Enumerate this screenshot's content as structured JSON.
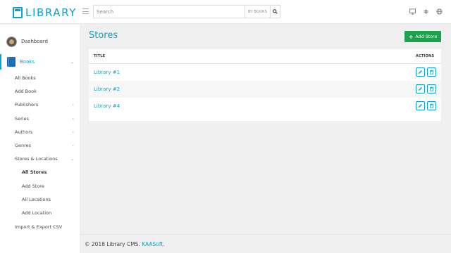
{
  "app": {
    "logo_text": "LIBRARY"
  },
  "search": {
    "placeholder": "Search",
    "value": "",
    "filter_label": "BY BOOKS"
  },
  "topbar": {
    "icons": [
      "monitor-icon",
      "gear-icon",
      "globe-icon"
    ]
  },
  "sidebar": {
    "dashboard": "Dashboard",
    "books": "Books",
    "items": [
      "All Books",
      "Add Book",
      "Publishers",
      "Series",
      "Authors",
      "Genres",
      "Stores & Locations"
    ],
    "stores_sub": [
      "All Stores",
      "Add Store",
      "All Locations",
      "Add Location"
    ],
    "import_export": "Import & Export CSV"
  },
  "page": {
    "title": "Stores",
    "add_button": "Add Store"
  },
  "table": {
    "headers": [
      "TITLE",
      "ACTIONS"
    ],
    "rows": [
      {
        "title": "Library #1"
      },
      {
        "title": "Library #2"
      },
      {
        "title": "Library #4"
      }
    ]
  },
  "footer": {
    "text": "© 2018 Library CMS.",
    "link": "KAASoft."
  },
  "colors": {
    "accent": "#0aa2c9",
    "add_button": "#1aa34a",
    "background": "#f0f0f0"
  }
}
